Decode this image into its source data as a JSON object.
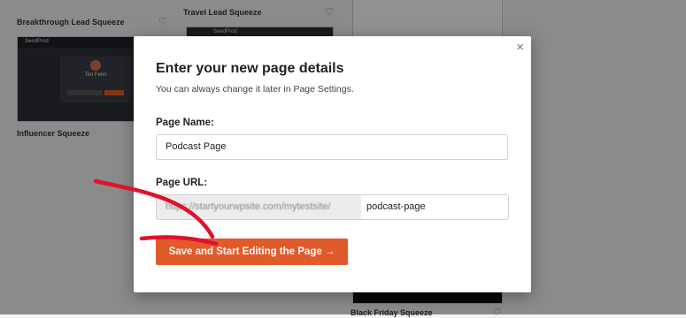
{
  "templates": [
    {
      "name": "Breakthrough Lead Squeeze"
    },
    {
      "name": "Travel Lead Squeeze"
    },
    {
      "name": "Influencer Squeeze"
    },
    {
      "name": "Black Friday Squeeze"
    }
  ],
  "thumb_influencer": {
    "brand": "SeedProd",
    "person": "Tim Fenn"
  },
  "thumb_travel": {
    "brand": "SeedProd"
  },
  "modal": {
    "close_glyph": "×",
    "title": "Enter your new page details",
    "subtitle": "You can always change it later in Page Settings.",
    "page_name_label": "Page Name:",
    "page_name_value": "Podcast Page",
    "page_url_label": "Page URL:",
    "url_prefix": "https://startyourwpsite.com/mytestsite/",
    "url_slug": "podcast-page",
    "submit_label": "Save and Start Editing the Page  →"
  },
  "colors": {
    "accent": "#e05a2b",
    "annotation": "#e0112b"
  },
  "icons": {
    "favorite": "heart-icon",
    "close": "close-icon"
  }
}
